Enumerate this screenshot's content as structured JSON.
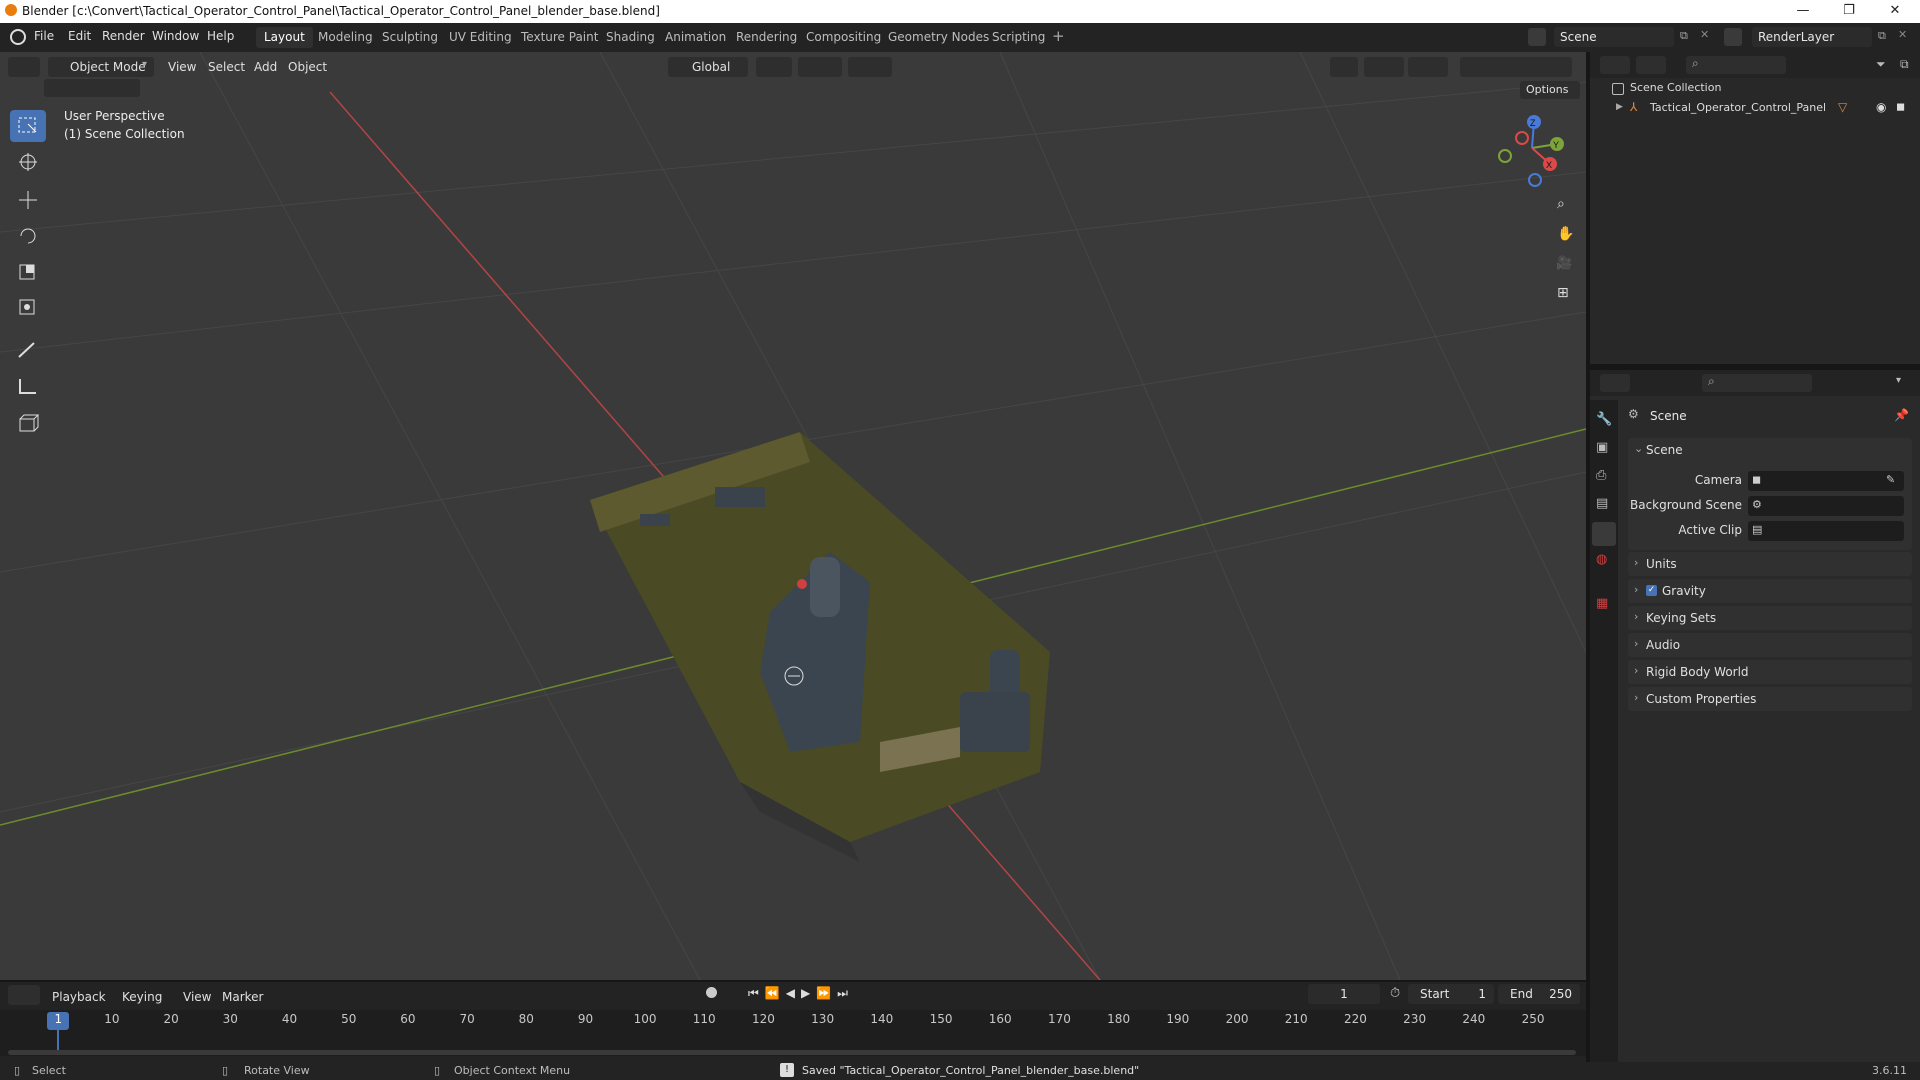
{
  "window": {
    "title": "Blender [c:\\Convert\\Tactical_Operator_Control_Panel\\Tactical_Operator_Control_Panel_blender_base.blend]",
    "controls": [
      "minimize-icon",
      "maximize-icon",
      "close-icon"
    ]
  },
  "menu": [
    "File",
    "Edit",
    "Render",
    "Window",
    "Help"
  ],
  "workspaces": [
    "Layout",
    "Modeling",
    "Sculpting",
    "UV Editing",
    "Texture Paint",
    "Shading",
    "Animation",
    "Rendering",
    "Compositing",
    "Geometry Nodes",
    "Scripting"
  ],
  "active_workspace": "Layout",
  "scene_selector": "Scene",
  "view_layer": "RenderLayer",
  "viewport": {
    "mode": "Object Mode",
    "menus": [
      "View",
      "Select",
      "Add",
      "Object"
    ],
    "orientation": "Global",
    "options": "Options",
    "overlay_line1": "User Perspective",
    "overlay_line2": "(1) Scene Collection",
    "tools": [
      "select-box-icon",
      "cursor-icon",
      "move-icon",
      "rotate-icon",
      "scale-icon",
      "transform-icon",
      "annotate-icon",
      "measure-icon",
      "add-cube-icon"
    ],
    "axes": [
      "X",
      "Y",
      "Z"
    ]
  },
  "outliner": {
    "root": "Scene Collection",
    "items": [
      {
        "name": "Tactical_Operator_Control_Panel"
      }
    ]
  },
  "properties": {
    "header": "Scene",
    "section": "Scene",
    "fields": [
      {
        "label": "Camera",
        "value": ""
      },
      {
        "label": "Background Scene",
        "value": ""
      },
      {
        "label": "Active Clip",
        "value": ""
      }
    ],
    "panels": [
      "Units",
      "Gravity",
      "Keying Sets",
      "Audio",
      "Rigid Body World",
      "Custom Properties"
    ],
    "gravity_checked": true
  },
  "timeline": {
    "menus": [
      "Playback",
      "Keying",
      "View",
      "Marker"
    ],
    "current_frame": "1",
    "start_label": "Start",
    "start": "1",
    "end_label": "End",
    "end": "250",
    "ticks": [
      "1",
      "10",
      "20",
      "30",
      "40",
      "50",
      "60",
      "70",
      "80",
      "90",
      "100",
      "110",
      "120",
      "130",
      "140",
      "150",
      "160",
      "170",
      "180",
      "190",
      "200",
      "210",
      "220",
      "230",
      "240",
      "250"
    ]
  },
  "status": {
    "select": "Select",
    "rotate": "Rotate View",
    "context": "Object Context Menu",
    "message": "Saved \"Tactical_Operator_Control_Panel_blender_base.blend\"",
    "version": "3.6.11"
  },
  "colors": {
    "accent": "#4772b3",
    "x_axis": "#d94a4a",
    "y_axis": "#7ea33a",
    "z_axis": "#4a7ad9",
    "brand": "#e87d0d"
  }
}
